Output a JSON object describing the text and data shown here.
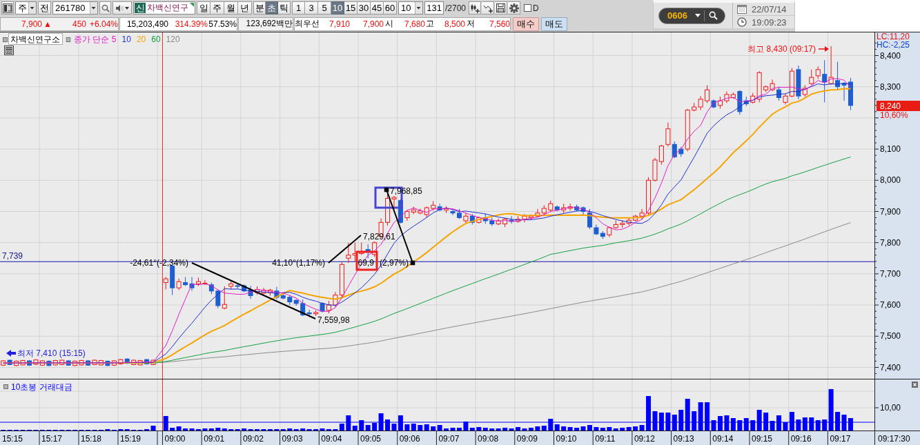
{
  "toolbar": {
    "market_select": {
      "value": "주"
    },
    "prev_button": {
      "label": "전"
    },
    "code_field": {
      "value": "261780"
    },
    "stock_field": {
      "badge": "신",
      "value": "차백신연구"
    },
    "chart_types": [
      {
        "label": "일",
        "selected": false
      },
      {
        "label": "주",
        "selected": false
      },
      {
        "label": "월",
        "selected": false
      },
      {
        "label": "년",
        "selected": false
      }
    ],
    "units": [
      {
        "label": "분",
        "selected": false
      },
      {
        "label": "초",
        "selected": true
      },
      {
        "label": "틱",
        "selected": false
      }
    ],
    "intervals": [
      {
        "label": "1",
        "selected": false
      },
      {
        "label": "3",
        "selected": false
      },
      {
        "label": "5",
        "selected": false
      },
      {
        "label": "10",
        "selected": true
      },
      {
        "label": "15",
        "selected": false
      },
      {
        "label": "30",
        "selected": false
      },
      {
        "label": "45",
        "selected": false
      },
      {
        "label": "60",
        "selected": false
      }
    ],
    "interval_select": {
      "value": "10"
    },
    "count_field": {
      "value": "131"
    },
    "count_total": "/2700",
    "d_option": {
      "label": "D",
      "checked": false
    }
  },
  "quote_bar": {
    "cells": [
      {
        "kind": "shaded",
        "items": [
          {
            "text": "7,900",
            "kind": "up"
          },
          {
            "text": "▲",
            "kind": "arrow"
          },
          {
            "text": "450",
            "kind": "up"
          },
          {
            "text": "+6.04%",
            "kind": "up"
          }
        ]
      },
      {
        "kind": "plain",
        "items": [
          {
            "text": "15,203,490",
            "kind": "neutral"
          },
          {
            "text": "314.39%",
            "kind": "up"
          },
          {
            "text": "57.53%",
            "kind": "neutral"
          }
        ]
      },
      {
        "kind": "shaded",
        "items": [
          {
            "text": "123,692백만",
            "kind": "neutral"
          }
        ]
      },
      {
        "kind": "plain",
        "items": [
          {
            "text": "최우선",
            "kind": "label"
          },
          {
            "text": "7,910",
            "kind": "up"
          },
          {
            "text": "7,900",
            "kind": "up"
          },
          {
            "text": "시",
            "kind": "label"
          },
          {
            "text": "7,680",
            "kind": "up"
          },
          {
            "text": "고",
            "kind": "label"
          },
          {
            "text": "8,500",
            "kind": "up"
          },
          {
            "text": "저",
            "kind": "label"
          },
          {
            "text": "7,560",
            "kind": "up"
          }
        ]
      }
    ],
    "buttons": [
      {
        "label": "매수",
        "kind": "buy"
      },
      {
        "label": "매도",
        "kind": "sell"
      }
    ]
  },
  "clock_panel": {
    "code_field": {
      "value": "0606"
    },
    "date": "22/07/14",
    "time": "19:09:23"
  },
  "price_chart": {
    "legend": {
      "stock_name": "차백신연구소",
      "ma_label": "종가 단순",
      "periods": [
        {
          "label": "5",
          "color": "#e41ec8"
        },
        {
          "label": "10",
          "color": "#1e2ed2"
        },
        {
          "label": "20",
          "color": "#f5a400"
        },
        {
          "label": "60",
          "color": "#12a040"
        },
        {
          "label": "120",
          "color": "#8a8a8a"
        }
      ]
    },
    "axis_header": {
      "lc": "LC:11,20",
      "hc": "HC:-2,25"
    },
    "y_axis_labels": [
      "8,400",
      "8,300",
      "8,100",
      "8,000",
      "7,900",
      "7,800",
      "7,700",
      "7,600",
      "7,500",
      "7,400"
    ],
    "current_price": {
      "price": "8,240",
      "change": "10,60%"
    },
    "reference_line": {
      "label": "7,739"
    },
    "high_marker": {
      "label": "최고 8,430 (09:17)"
    },
    "low_marker": {
      "label": "최저 7,410 (15:15)"
    },
    "trend_lines": [
      {
        "angle_label": "-24,61°(-2,34%)",
        "end_label": "7,559,98"
      },
      {
        "angle_label": "41,10°(1,17%)",
        "end_label": "7,829,61"
      },
      {
        "angle_label": "69,9",
        "rate_label": "(2,97%)",
        "end_label": "7,968,85"
      }
    ]
  },
  "volume_chart": {
    "title": "10초봉 거래대금",
    "axis_label": "10,00"
  },
  "time_axis": {
    "labels": [
      "15:15",
      "15:17",
      "15:18",
      "15:19",
      "09:00",
      "09:01",
      "09:02",
      "09:03",
      "09:04",
      "09:05",
      "09:06",
      "09:07",
      "09:08",
      "09:09",
      "09:10",
      "09:11",
      "09:12",
      "09:13",
      "09:14",
      "09:15",
      "09:16",
      "09:17"
    ],
    "cursor_label": "09:17:30"
  }
}
